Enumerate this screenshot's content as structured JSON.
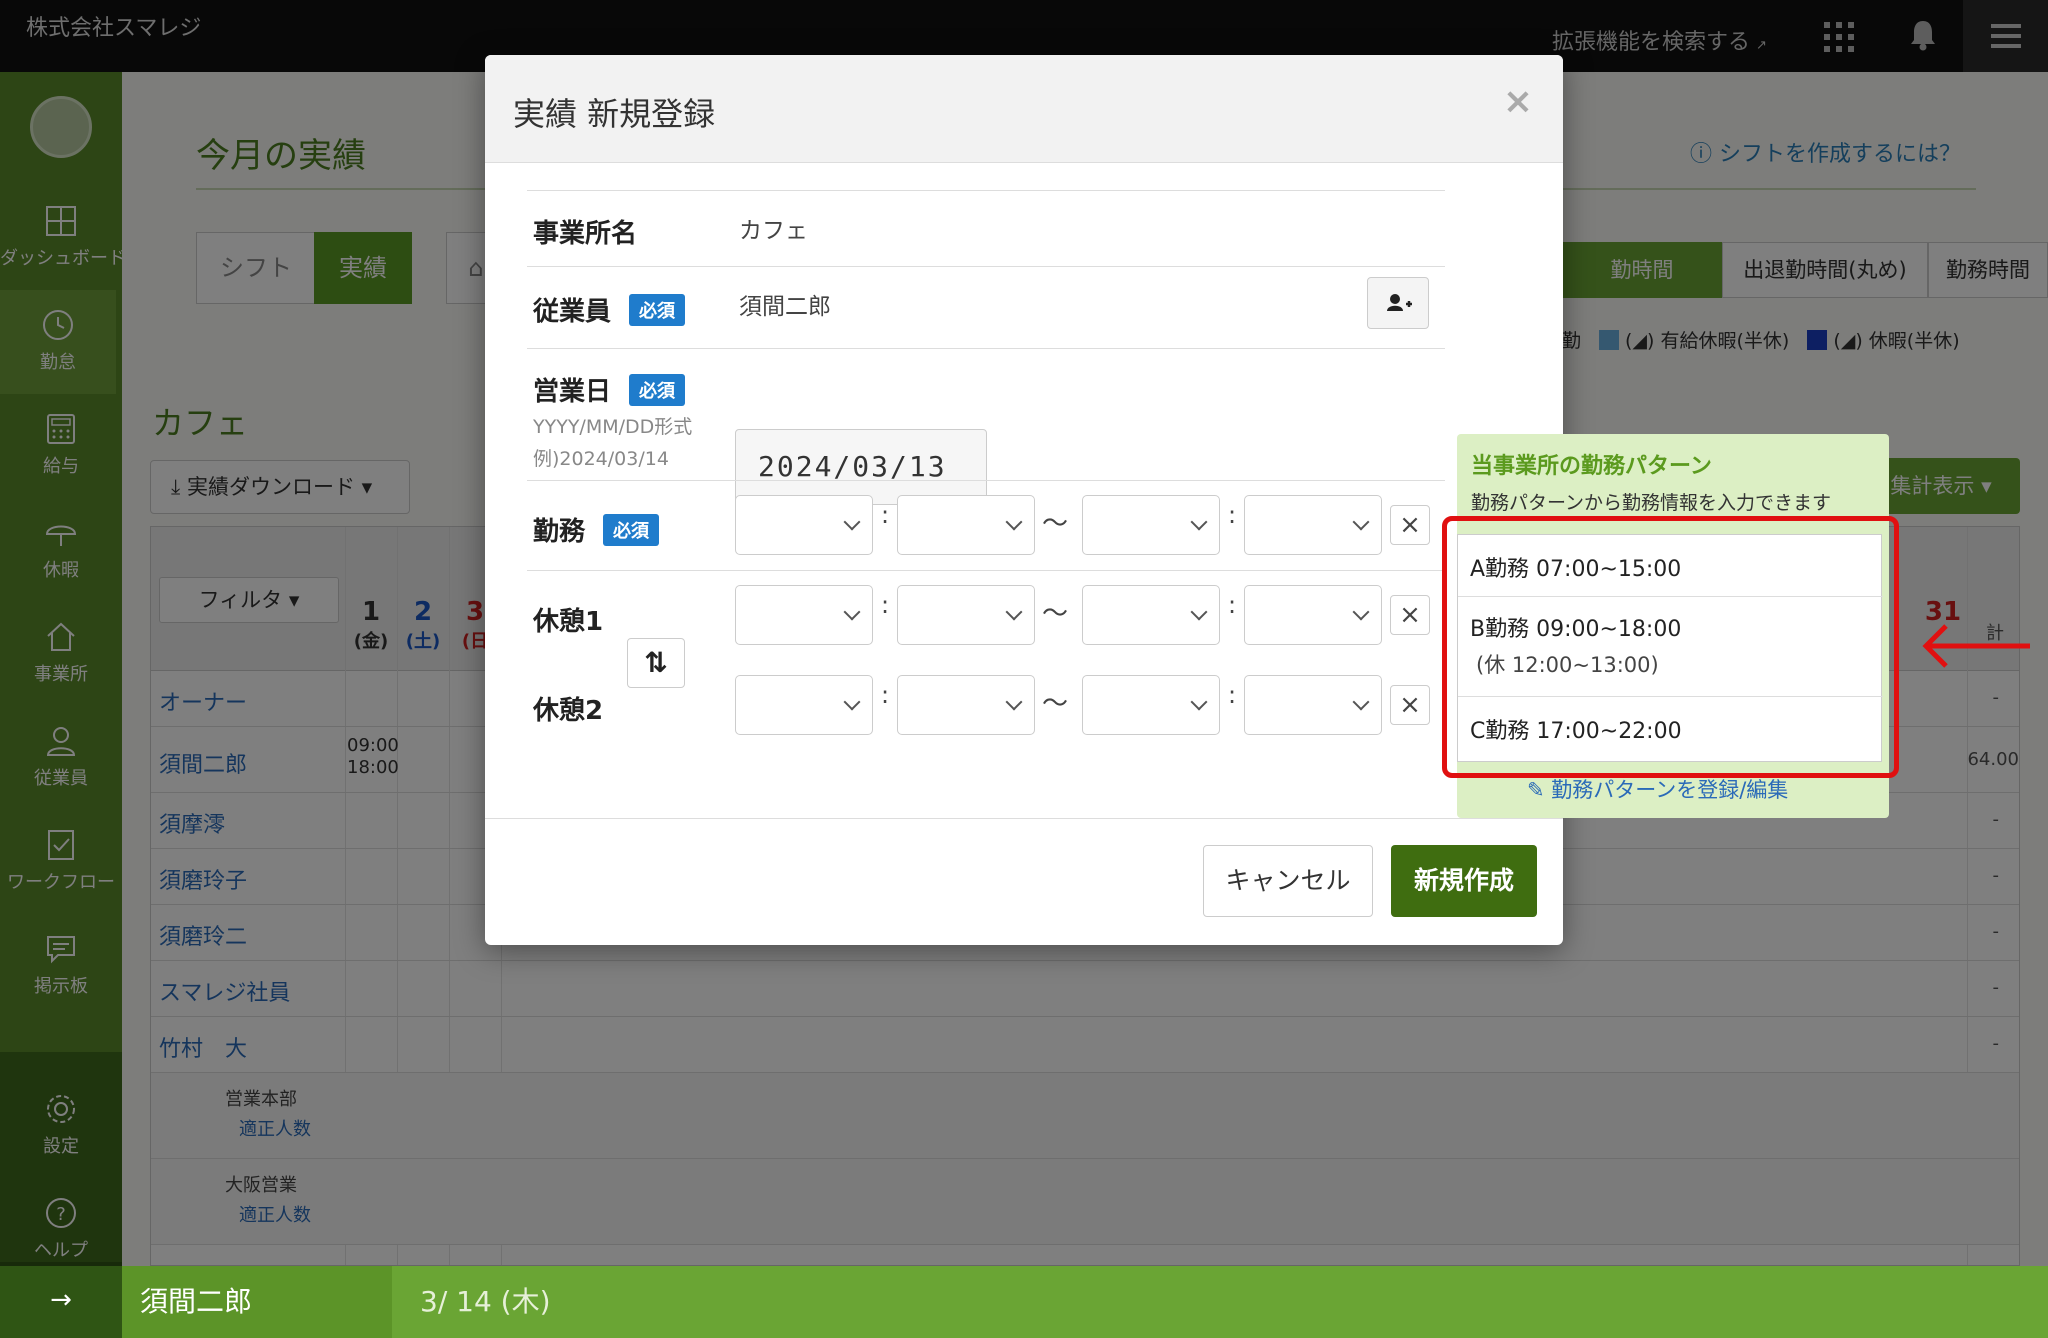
{
  "topbar": {
    "company": "株式会社スマレジ",
    "ext_search": "拡張機能を検索する"
  },
  "sidebar": {
    "items": [
      {
        "label": "ダッシュボード",
        "icon": "dashboard-icon"
      },
      {
        "label": "勤怠",
        "icon": "clock-icon"
      },
      {
        "label": "給与",
        "icon": "calculator-icon"
      },
      {
        "label": "休暇",
        "icon": "umbrella-icon"
      },
      {
        "label": "事業所",
        "icon": "home-icon"
      },
      {
        "label": "従業員",
        "icon": "person-icon"
      },
      {
        "label": "ワークフロー",
        "icon": "checklist-icon"
      },
      {
        "label": "掲示板",
        "icon": "board-icon"
      },
      {
        "label": "設定",
        "icon": "gear-icon"
      },
      {
        "label": "ヘルプ",
        "icon": "help-icon"
      }
    ],
    "expand_icon": "→"
  },
  "main": {
    "title": "今月の実績",
    "help_link": "シフトを作成するには？",
    "segments": [
      "シフト",
      "実績"
    ],
    "view_tabs": [
      "勤時間",
      "出退勤時間(丸め)",
      "勤務時間"
    ],
    "legend": [
      "勤",
      "(◢) 有給休暇(半休)",
      "(◢) 休暇(半休)"
    ],
    "shop_name": "カフェ",
    "download_btn": "実績ダウンロード",
    "summary_btn": "集計表示",
    "filter_btn": "フィルタ",
    "days": [
      {
        "num": "1",
        "dow": "(金)",
        "color": "normal"
      },
      {
        "num": "2",
        "dow": "(土)",
        "color": "blue"
      },
      {
        "num": "3",
        "dow": "(日",
        "color": "red"
      }
    ],
    "last_day": {
      "num": "31",
      "label": "計"
    },
    "rows": [
      {
        "name": "オーナー",
        "total": "-"
      },
      {
        "name": "須間二郎",
        "time1": "09:00",
        "time2": "18:00",
        "total": "64.00"
      },
      {
        "name": "須摩澪",
        "total": "-"
      },
      {
        "name": "須磨玲子",
        "total": "-"
      },
      {
        "name": "須磨玲二",
        "total": "-"
      },
      {
        "name": "スマレジ社員",
        "total": "-"
      },
      {
        "name": "竹村　大",
        "total": "-"
      }
    ],
    "sub_rows": [
      {
        "org": "営業本部",
        "req": "適正人数"
      },
      {
        "org": "大阪営業",
        "req": "適正人数"
      }
    ]
  },
  "statusbar": {
    "employee": "須間二郎",
    "date": "3/ 14 (木)"
  },
  "modal": {
    "title": "実績 新規登録",
    "close": "×",
    "office_label": "事業所名",
    "office_value": "カフェ",
    "employee_label": "従業員",
    "employee_value": "須間二郎",
    "required": "必須",
    "date_label": "営業日",
    "date_hint1": "YYYY/MM/DD形式",
    "date_hint2": "例)2024/03/14",
    "date_value": "2024/03/13",
    "work_label": "勤務",
    "break1_label": "休憩1",
    "break2_label": "休憩2",
    "colon": ":",
    "tilde": "〜",
    "clear": "×",
    "cancel": "キャンセル",
    "create": "新規作成"
  },
  "pattern": {
    "title": "当事業所の勤務パターン",
    "desc": "勤務パターンから勤務情報を入力できます",
    "items": [
      {
        "label": "A勤務 07:00~15:00",
        "sub": ""
      },
      {
        "label": "B勤務 09:00~18:00",
        "sub": "(休 12:00~13:00)"
      },
      {
        "label": "C勤務 17:00~22:00",
        "sub": ""
      }
    ],
    "link": "勤務パターンを登録/編集"
  },
  "colors": {
    "brand_green": "#5a8a2a",
    "accent_blue": "#1f7ccc",
    "highlight_red": "#e01010"
  }
}
